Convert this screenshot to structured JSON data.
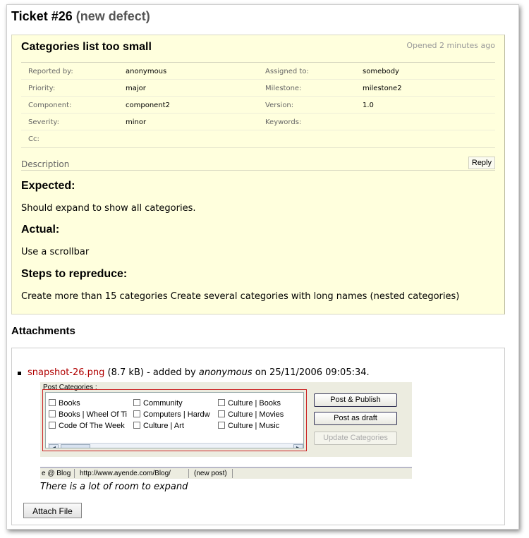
{
  "ticket": {
    "title": "Ticket #26",
    "status": "(new defect)",
    "summary": "Categories list too small",
    "opened": "Opened 2 minutes ago"
  },
  "properties": [
    {
      "label": "Reported by:",
      "value": "anonymous",
      "label2": "Assigned to:",
      "value2": "somebody"
    },
    {
      "label": "Priority:",
      "value": "major",
      "label2": "Milestone:",
      "value2": "milestone2"
    },
    {
      "label": "Component:",
      "value": "component2",
      "label2": "Version:",
      "value2": "1.0"
    },
    {
      "label": "Severity:",
      "value": "minor",
      "label2": "Keywords:",
      "value2": ""
    },
    {
      "label": "Cc:",
      "value": "",
      "label2": "",
      "value2": ""
    }
  ],
  "description": {
    "label": "Description",
    "reply": "Reply",
    "expected_heading": "Expected:",
    "expected_text": "Should expand to show all categories.",
    "actual_heading": "Actual:",
    "actual_text": "Use a scrollbar",
    "steps_heading": "Steps to repreduce:",
    "steps_text": "Create more than 15 categories Create several categories with long names (nested categories)"
  },
  "attachments": {
    "title": "Attachments",
    "file_name": "snapshot-26.png",
    "file_size": "(8.7 kB)",
    "added_by_prefix": "- added by",
    "author": "anonymous",
    "on_text": "on 25/11/2006 09:05:34.",
    "caption": "There is a lot of room to expand",
    "attach_button": "Attach File"
  },
  "screenshot": {
    "legend": "Post Categories :",
    "categories": [
      "Books",
      "Community",
      "Culture | Books",
      "Books | Wheel Of Ti",
      "Computers | Hardw",
      "Culture | Movies",
      "Code Of The Week",
      "Culture | Art",
      "Culture | Music"
    ],
    "buttons": [
      "Post & Publish",
      "Post as draft",
      "Update Categories"
    ],
    "status_items": [
      "e @ Blog",
      "http://www.ayende.com/Blog/",
      "(new post)"
    ]
  }
}
